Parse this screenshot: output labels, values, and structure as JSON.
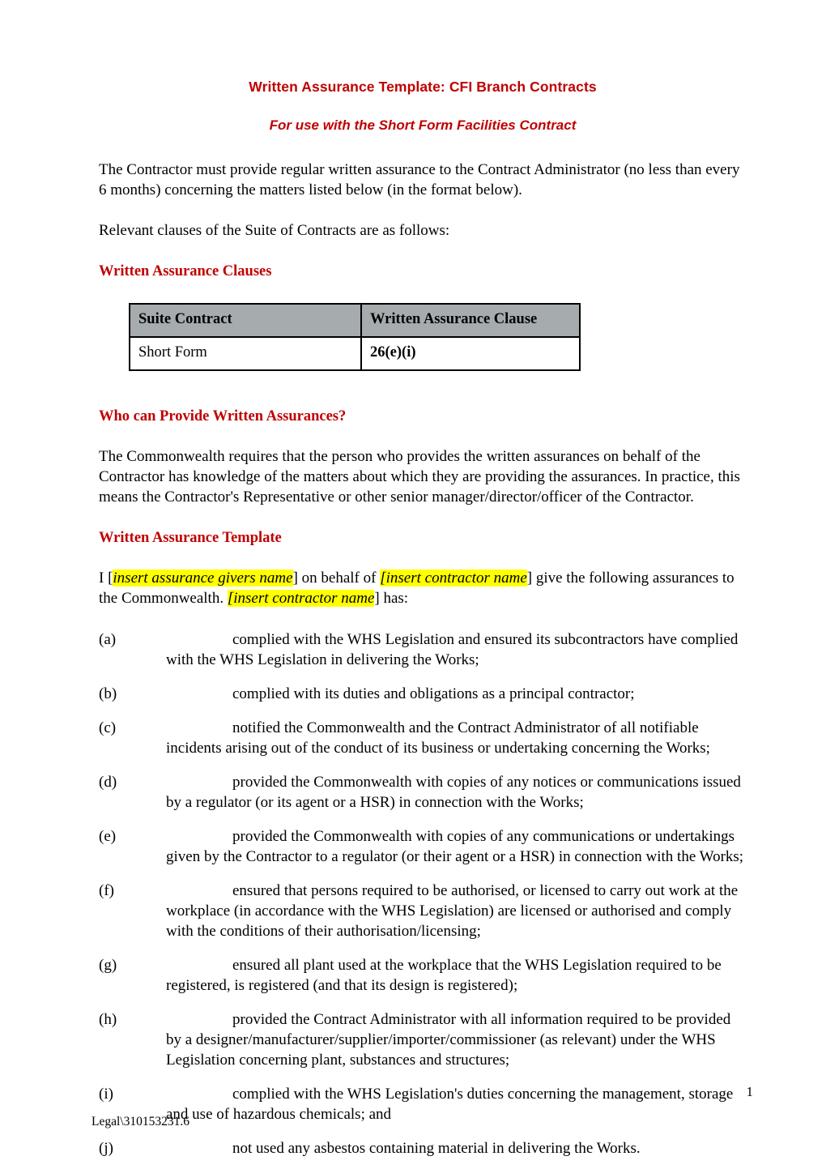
{
  "document": {
    "title": "Written Assurance Template: CFI  Branch Contracts",
    "subtitle": "For use with the Short Form Facilities Contract",
    "intro_paragraph": "The Contractor must provide regular written assurance to the Contract Administrator (no less than every 6 months) concerning the matters listed below (in the format below).",
    "relevant_clauses_paragraph": "Relevant clauses of the Suite of Contracts are as follows:",
    "accent_color": "#C00000",
    "highlight_color": "#FFFF00",
    "table_header_color": "#A6ABAE"
  },
  "sections": {
    "clauses_heading": "Written Assurance Clauses",
    "who_heading": "Who can Provide Written Assurances?",
    "who_paragraph": "The Commonwealth requires that the person who provides the written assurances on behalf of the Contractor has knowledge of the matters about which they are providing the assurances. In practice, this means the Contractor's Representative or other senior manager/director/officer of the Contractor.",
    "template_heading": "Written Assurance Template"
  },
  "clause_table": {
    "headers": [
      "Suite Contract",
      "Written Assurance Clause"
    ],
    "rows": [
      [
        "Short Form",
        "26(e)(i)"
      ]
    ]
  },
  "template_paragraph": {
    "part1": "I [",
    "placeholder1": "insert assurance givers name",
    "part2": "] on behalf of  ",
    "placeholder2": "[insert contractor name",
    "part3": "] give the following assurances to the Commonwealth.  ",
    "placeholder3": "[insert contractor name",
    "part4": "] has:"
  },
  "assurances": [
    {
      "marker": "(a)",
      "text": "complied with the WHS Legislation and ensured its subcontractors have complied with the WHS Legislation in delivering the Works;"
    },
    {
      "marker": "(b)",
      "text": "complied with its duties and obligations as a principal contractor;"
    },
    {
      "marker": "(c)",
      "text": "notified the Commonwealth and the Contract Administrator of all notifiable incidents arising out of the conduct of its business or undertaking concerning the Works;"
    },
    {
      "marker": "(d)",
      "text": "provided the Commonwealth with copies of any notices or communications issued by a regulator (or its agent or a HSR) in connection with the Works;"
    },
    {
      "marker": "(e)",
      "text": "provided the Commonwealth with copies of any communications or undertakings given by the Contractor to a regulator (or their agent or a HSR) in connection with the Works;"
    },
    {
      "marker": "(f)",
      "text": "ensured that persons required to be authorised, or licensed to carry out work at the workplace (in accordance with the WHS Legislation) are licensed or authorised and comply with the conditions of their authorisation/licensing;"
    },
    {
      "marker": "(g)",
      "text": "ensured all plant  used at the workplace that the WHS Legislation required to be registered, is registered (and that its design is registered);"
    },
    {
      "marker": "(h)",
      "text": "provided the Contract Administrator with all information required to be provided by a designer/manufacturer/supplier/importer/commissioner (as relevant) under the WHS Legislation concerning plant, substances and structures;"
    },
    {
      "marker": "(i)",
      "text": "complied with the WHS Legislation's duties concerning the management, storage and use of hazardous chemicals; and"
    },
    {
      "marker": "(j)",
      "text": "not used any asbestos containing material in delivering the Works."
    }
  ],
  "footer": {
    "page_number": "1",
    "reference": "Legal\\310153231.6"
  }
}
